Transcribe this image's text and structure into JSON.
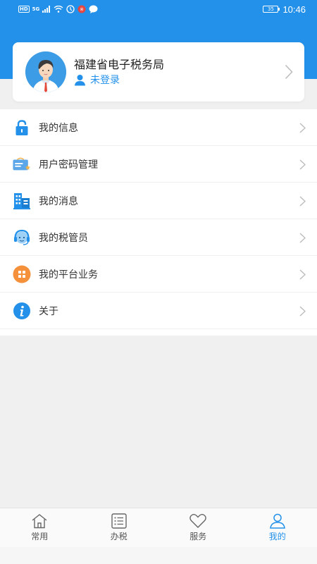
{
  "status_bar": {
    "network_badge": "HD",
    "network_type": "5G",
    "battery_level": "35",
    "time": "10:46",
    "icons": [
      "signal-icon",
      "wifi-icon",
      "data-saver-icon",
      "notification-icon",
      "chat-icon"
    ]
  },
  "profile": {
    "title": "福建省电子税务局",
    "login_status": "未登录"
  },
  "menu": {
    "items": [
      {
        "label": "我的信息",
        "icon": "lock-icon"
      },
      {
        "label": "用户密码管理",
        "icon": "password-card-icon"
      },
      {
        "label": "我的消息",
        "icon": "building-icon"
      },
      {
        "label": "我的税管员",
        "icon": "customer-service-icon"
      },
      {
        "label": "我的平台业务",
        "icon": "apps-grid-icon"
      },
      {
        "label": "关于",
        "icon": "info-icon"
      }
    ]
  },
  "tabbar": {
    "tabs": [
      {
        "label": "常用",
        "icon": "home-icon"
      },
      {
        "label": "办税",
        "icon": "list-icon"
      },
      {
        "label": "服务",
        "icon": "heart-icon"
      },
      {
        "label": "我的",
        "icon": "user-icon",
        "active": true
      }
    ]
  },
  "colors": {
    "brand": "#2391ea",
    "orange": "#f5913b",
    "background": "#f0f0f0"
  }
}
